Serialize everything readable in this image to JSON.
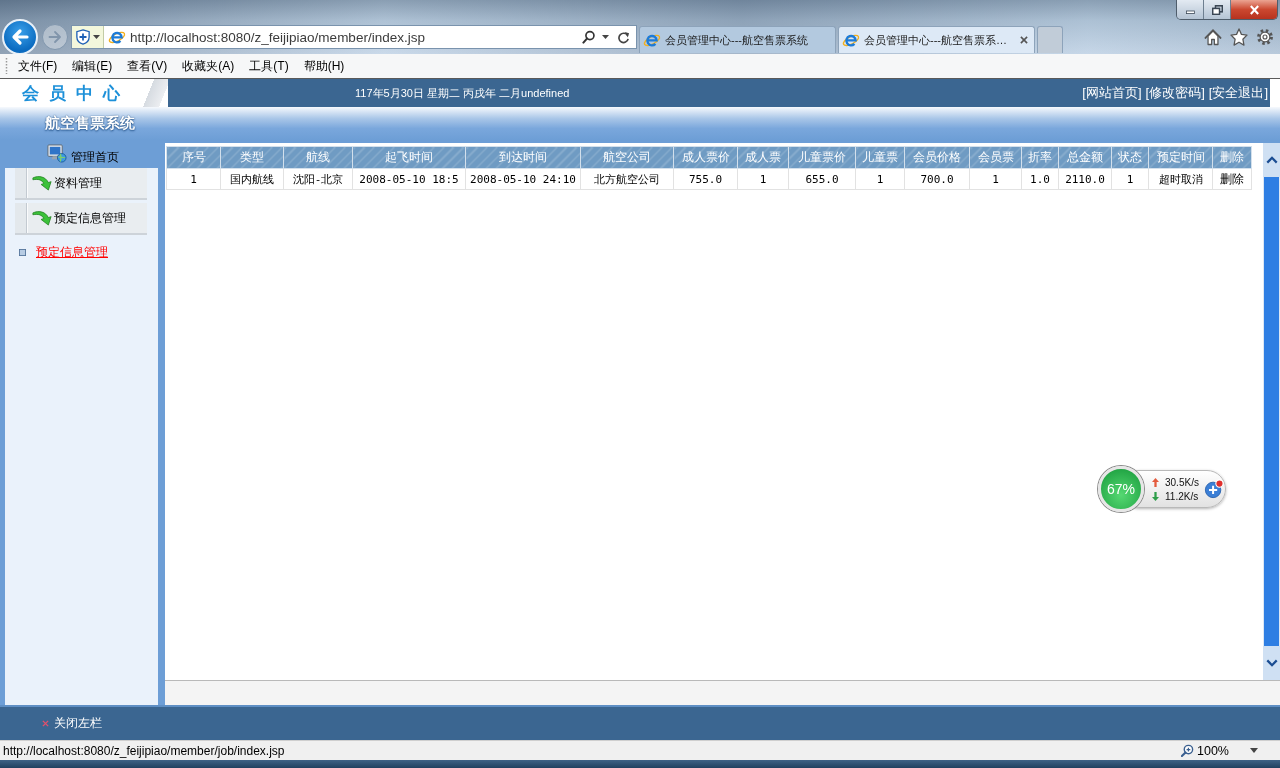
{
  "browser": {
    "address": "http://localhost:8080/z_feijipiao/member/index.jsp",
    "tabs": [
      {
        "title": "会员管理中心---航空售票系统",
        "selected": false
      },
      {
        "title": "会员管理中心---航空售票系…",
        "selected": true
      }
    ],
    "menu": [
      "文件(F)",
      "编辑(E)",
      "查看(V)",
      "收藏夹(A)",
      "工具(T)",
      "帮助(H)"
    ]
  },
  "header": {
    "logo": "会员中心",
    "date": "117年5月30日 星期二 丙戌年 二月undefined",
    "links": [
      "[网站首页]",
      "[修改密码]",
      "[安全退出]"
    ]
  },
  "title_band": {
    "title": "航空售票系统"
  },
  "sidebar": {
    "home": "管理首页",
    "items": [
      "资料管理",
      "预定信息管理"
    ],
    "links": [
      "预定信息管理"
    ]
  },
  "table": {
    "columns": [
      "序号",
      "类型",
      "航线",
      "起飞时间",
      "到达时间",
      "航空公司",
      "成人票价",
      "成人票",
      "儿童票价",
      "儿童票",
      "会员价格",
      "会员票",
      "折率",
      "总金额",
      "状态",
      "预定时间",
      "删除"
    ],
    "rows": [
      [
        "1",
        "国内航线",
        "沈阳-北京",
        "2008-05-10 18:5",
        "2008-05-10 24:10",
        "北方航空公司",
        "755.0",
        "1",
        "655.0",
        "1",
        "700.0",
        "1",
        "1.0",
        "2110.0",
        "1",
        "超时取消",
        "删除"
      ]
    ]
  },
  "footer": {
    "close_label": "关闭左栏"
  },
  "status_bar": {
    "url": "http://localhost:8080/z_feijipiao/member/job/index.jsp",
    "zoom": "100%"
  },
  "network_widget": {
    "usage": "67%",
    "upload": "30.5K/s",
    "download": "11.2K/s"
  }
}
